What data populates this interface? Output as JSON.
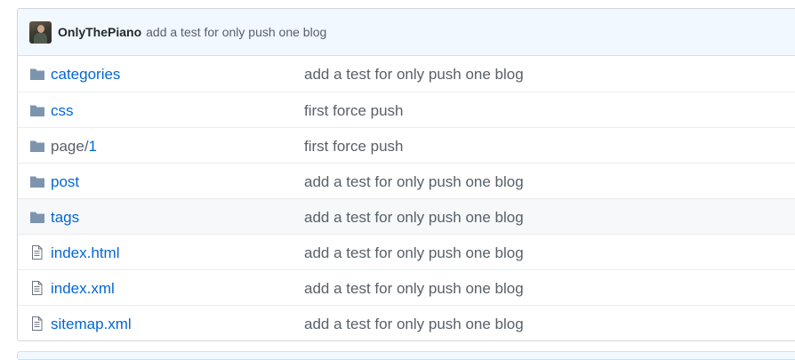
{
  "commit": {
    "author": "OnlyThePiano",
    "message": "add a test for only push one blog"
  },
  "files": [
    {
      "type": "folder",
      "icon": "folder-icon",
      "prefix": "",
      "name": "categories",
      "message": "add a test for only push one blog"
    },
    {
      "type": "folder",
      "icon": "folder-icon",
      "prefix": "",
      "name": "css",
      "message": "first force push"
    },
    {
      "type": "folder",
      "icon": "folder-icon",
      "prefix": "page/",
      "name": "1",
      "message": "first force push"
    },
    {
      "type": "folder",
      "icon": "folder-icon",
      "prefix": "",
      "name": "post",
      "message": "add a test for only push one blog"
    },
    {
      "type": "folder",
      "icon": "folder-icon",
      "prefix": "",
      "name": "tags",
      "message": "add a test for only push one blog"
    },
    {
      "type": "file",
      "icon": "file-icon",
      "prefix": "",
      "name": "index.html",
      "message": "add a test for only push one blog"
    },
    {
      "type": "file",
      "icon": "file-icon",
      "prefix": "",
      "name": "index.xml",
      "message": "add a test for only push one blog"
    },
    {
      "type": "file",
      "icon": "file-icon",
      "prefix": "",
      "name": "sitemap.xml",
      "message": "add a test for only push one blog"
    }
  ],
  "colors": {
    "link": "#0366d6",
    "muted": "#586069",
    "folder_icon": "#79b8ff",
    "commit_bar_bg": "#f1f8ff"
  }
}
